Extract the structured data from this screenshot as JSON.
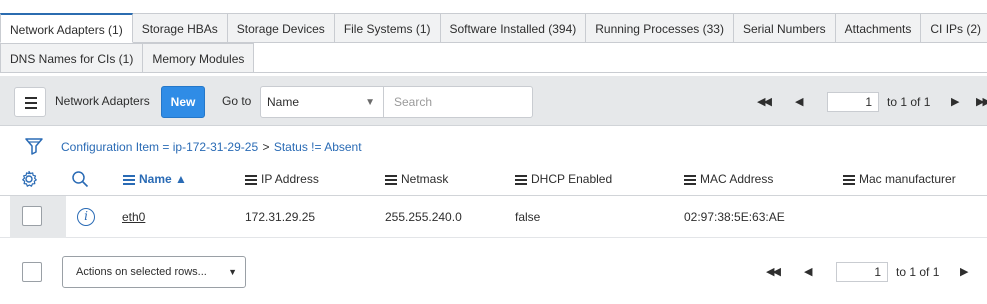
{
  "tabs": {
    "row1": [
      {
        "label": "Network Adapters (1)",
        "active": true
      },
      {
        "label": "Storage HBAs"
      },
      {
        "label": "Storage Devices"
      },
      {
        "label": "File Systems (1)"
      },
      {
        "label": "Software Installed (394)"
      },
      {
        "label": "Running Processes (33)"
      },
      {
        "label": "Serial Numbers"
      },
      {
        "label": "Attachments"
      },
      {
        "label": "CI IPs (2)"
      }
    ],
    "row2": [
      {
        "label": "DNS Names for CIs (1)"
      },
      {
        "label": "Memory Modules"
      }
    ]
  },
  "toolbar": {
    "list_title": "Network Adapters",
    "new_label": "New",
    "goto_label": "Go to",
    "goto_field": "Name",
    "search_placeholder": "Search"
  },
  "pager": {
    "page": "1",
    "of_text": "to 1 of 1"
  },
  "breadcrumb": {
    "part1": "Configuration Item = ip-172-31-29-25",
    "separator": ">",
    "part2": "Status != Absent"
  },
  "columns": {
    "name": "Name",
    "ip": "IP Address",
    "netmask": "Netmask",
    "dhcp": "DHCP Enabled",
    "mac": "MAC Address",
    "manufacturer": "Mac manufacturer"
  },
  "rows": [
    {
      "name": "eth0",
      "ip": "172.31.29.25",
      "netmask": "255.255.240.0",
      "dhcp": "false",
      "mac": "02:97:38:5E:63:AE",
      "manufacturer": ""
    }
  ],
  "footer": {
    "actions_label": "Actions on selected rows...",
    "page": "1",
    "of_text": "to 1 of 1"
  },
  "colors": {
    "accent": "#2f8ce6",
    "link": "#2a6bb5",
    "toolbar_bg": "#e6e8ea"
  }
}
